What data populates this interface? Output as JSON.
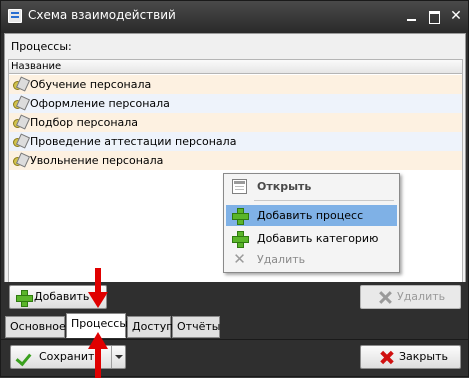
{
  "window": {
    "title": "Схема взаимодействий"
  },
  "processes_label": "Процессы:",
  "grid": {
    "header": "Название",
    "rows": [
      "Обучение персонала",
      "Оформление персонала",
      "Подбор персонала",
      "Проведение аттестации персонала",
      "Увольнение персонала"
    ]
  },
  "context_menu": {
    "open": "Открыть",
    "add_process": "Добавить процесс",
    "add_category": "Добавить категорию",
    "delete": "Удалить"
  },
  "toolbar": {
    "add": "Добавить",
    "delete": "Удалить"
  },
  "tabs": [
    "Основное",
    "Процессы",
    "Доступ",
    "Отчёты"
  ],
  "footer": {
    "save": "Сохранить",
    "close": "Закрыть"
  },
  "colors": {
    "highlight": "#7fb1e6",
    "annotation_arrow": "#e00000"
  }
}
